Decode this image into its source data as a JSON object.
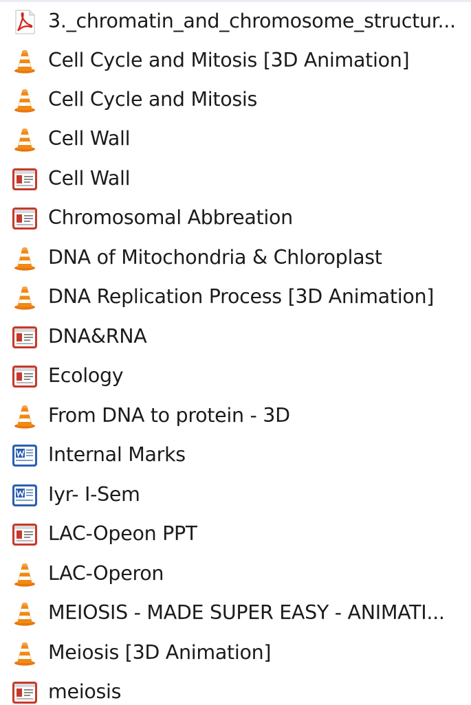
{
  "files": [
    {
      "name": "3._chromatin_and_chromosome_structur...",
      "icon": "pdf-icon"
    },
    {
      "name": "Cell Cycle and Mitosis [3D Animation]",
      "icon": "vlc-icon"
    },
    {
      "name": "Cell Cycle and Mitosis",
      "icon": "vlc-icon"
    },
    {
      "name": "Cell Wall",
      "icon": "vlc-icon"
    },
    {
      "name": "Cell Wall",
      "icon": "powerpoint-icon"
    },
    {
      "name": "Chromosomal Abbreation",
      "icon": "powerpoint-icon"
    },
    {
      "name": "DNA of Mitochondria & Chloroplast",
      "icon": "vlc-icon"
    },
    {
      "name": "DNA Replication Process [3D Animation]",
      "icon": "vlc-icon"
    },
    {
      "name": "DNA&RNA",
      "icon": "powerpoint-icon"
    },
    {
      "name": "Ecology",
      "icon": "powerpoint-icon"
    },
    {
      "name": "From DNA to protein - 3D",
      "icon": "vlc-icon"
    },
    {
      "name": "Internal Marks",
      "icon": "word-icon"
    },
    {
      "name": "Iyr- I-Sem",
      "icon": "word-icon"
    },
    {
      "name": "LAC-Opeon PPT",
      "icon": "powerpoint-icon"
    },
    {
      "name": "LAC-Operon",
      "icon": "vlc-icon"
    },
    {
      "name": "MEIOSIS - MADE SUPER EASY - ANIMATI...",
      "icon": "vlc-icon"
    },
    {
      "name": "Meiosis [3D Animation]",
      "icon": "vlc-icon"
    },
    {
      "name": "meiosis",
      "icon": "powerpoint-icon"
    }
  ]
}
